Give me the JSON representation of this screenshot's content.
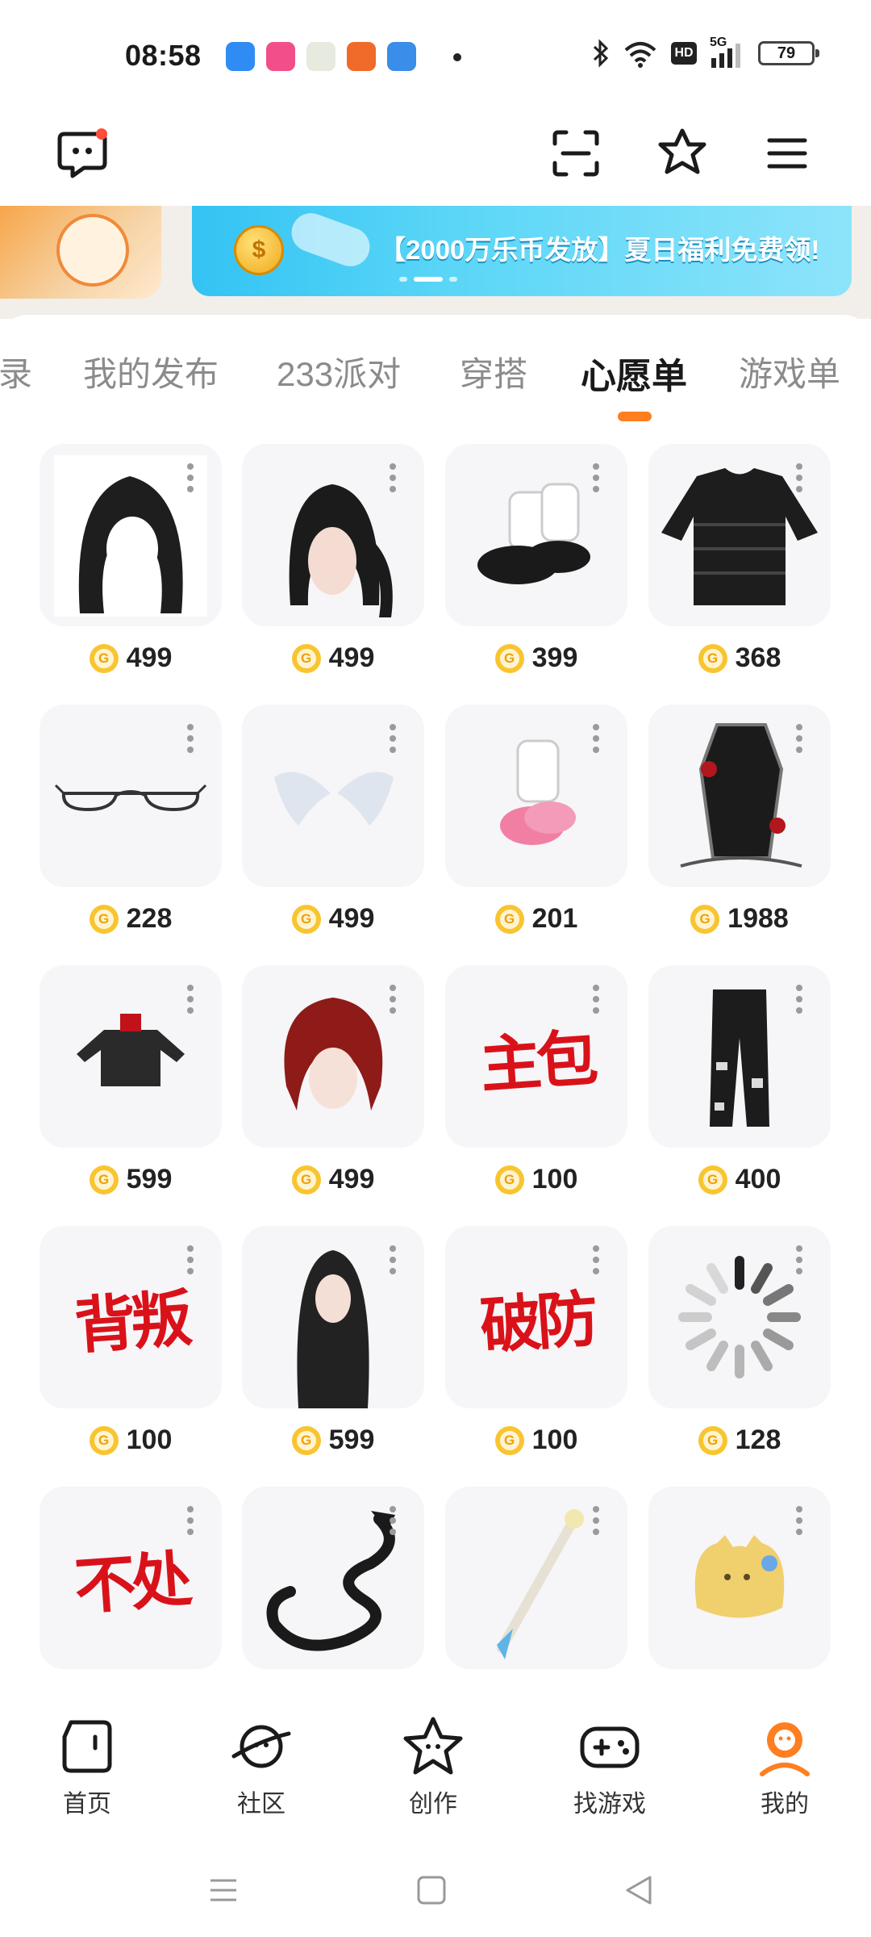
{
  "status_bar": {
    "time": "08:58",
    "battery": "79",
    "hd": "HD",
    "network": "5G",
    "icons": [
      "bluetooth-icon",
      "wifi-icon",
      "hd-icon",
      "signal-icon",
      "battery-icon"
    ],
    "app_icon_colors": [
      "#2f8cf5",
      "#f24e8a",
      "#e7eadf",
      "#f06a2a",
      "#3a8de8"
    ]
  },
  "header": {
    "icons": [
      "chat-bubble-icon",
      "scan-icon",
      "star-burst-icon",
      "menu-icon"
    ]
  },
  "banner": {
    "text": "【2000万乐币发放】夏日福利免费领!",
    "coin_mark": "$"
  },
  "tabs": {
    "items": [
      "录",
      "我的发布",
      "233派对",
      "穿搭",
      "心愿单",
      "游戏单"
    ],
    "active_index": 4
  },
  "wishlist": {
    "items": [
      {
        "name": "black-long-hair",
        "price": "499"
      },
      {
        "name": "black-twintail-hair",
        "price": "499"
      },
      {
        "name": "bunny-slippers",
        "price": "399"
      },
      {
        "name": "striped-tshirt",
        "price": "368"
      },
      {
        "name": "glasses",
        "price": "228"
      },
      {
        "name": "angel-wings",
        "price": "499"
      },
      {
        "name": "pink-shoes",
        "price": "201"
      },
      {
        "name": "coffin",
        "price": "1988"
      },
      {
        "name": "black-jacket",
        "price": "599"
      },
      {
        "name": "red-hair",
        "price": "499"
      },
      {
        "name": "text-art-zhubao",
        "price": "100",
        "art_text": "主包"
      },
      {
        "name": "ripped-jeans",
        "price": "400"
      },
      {
        "name": "text-art-beipan",
        "price": "100",
        "art_text": "背叛"
      },
      {
        "name": "long-straight-hair",
        "price": "599"
      },
      {
        "name": "text-art-pofang",
        "price": "100",
        "art_text": "破防"
      },
      {
        "name": "loading-spinner",
        "price": "128"
      },
      {
        "name": "text-art-buchu",
        "price": "",
        "art_text": "不处"
      },
      {
        "name": "black-dragon",
        "price": ""
      },
      {
        "name": "magic-staff",
        "price": ""
      },
      {
        "name": "yellow-blob",
        "price": ""
      }
    ]
  },
  "bottom_nav": {
    "items": [
      {
        "label": "首页",
        "icon": "home-icon"
      },
      {
        "label": "社区",
        "icon": "planet-icon"
      },
      {
        "label": "创作",
        "icon": "star-face-icon"
      },
      {
        "label": "找游戏",
        "icon": "gamepad-icon"
      },
      {
        "label": "我的",
        "icon": "profile-icon"
      }
    ],
    "active_index": 4,
    "active_color": "#ff7e1f"
  },
  "system_nav": {
    "icons": [
      "recent-apps-icon",
      "home-square-icon",
      "back-triangle-icon"
    ]
  },
  "colors": {
    "accent": "#ff7e1f",
    "coin": "#f8c531",
    "text_art_red": "#d9121a"
  }
}
